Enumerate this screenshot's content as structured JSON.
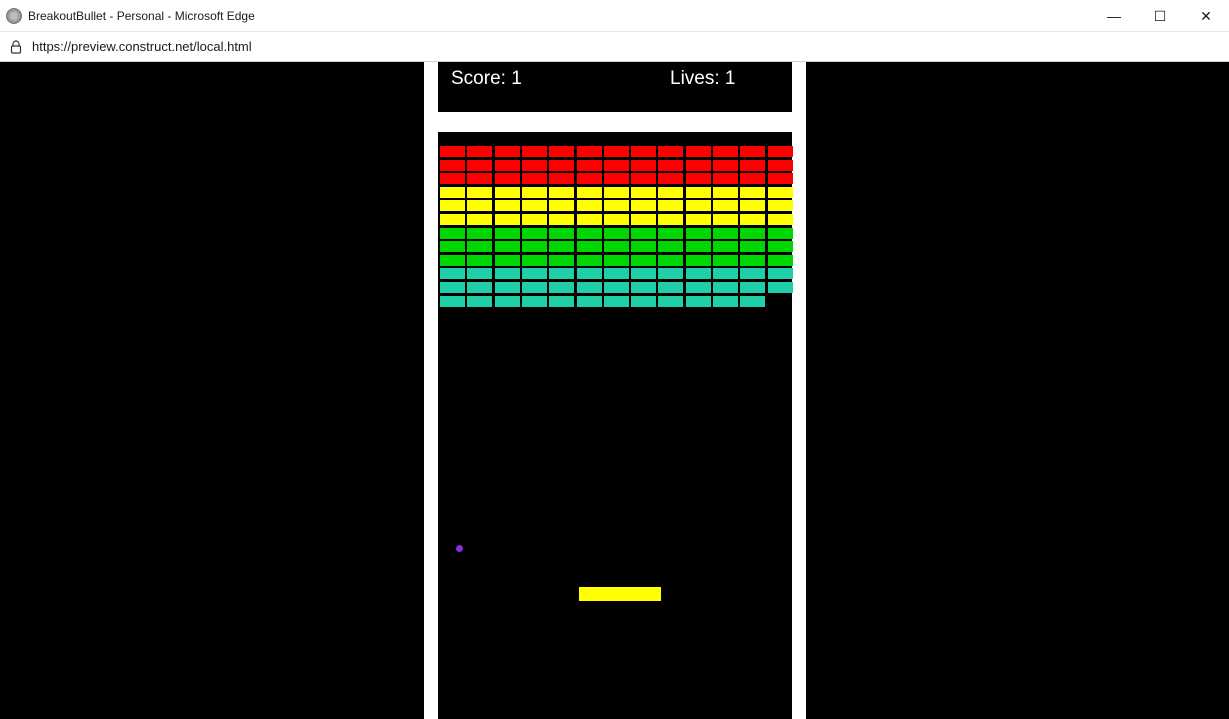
{
  "window": {
    "title": "BreakoutBullet - Personal - Microsoft Edge",
    "minimize_glyph": "—",
    "maximize_glyph": "☐",
    "close_glyph": "✕"
  },
  "address_bar": {
    "url": "https://preview.construct.net/local.html"
  },
  "game": {
    "score_text": "Score: 1",
    "lives_text": "Lives: 1",
    "score": 1,
    "lives": 1,
    "colors": {
      "red": "#ff0000",
      "yellow": "#ffff00",
      "green": "#00d600",
      "teal": "#1fcfa8",
      "ball": "#8a2be2",
      "paddle": "#ffff00",
      "frame": "#ffffff",
      "background": "#000000"
    },
    "brick_rows": [
      {
        "color": "red",
        "count": 13
      },
      {
        "color": "red",
        "count": 13
      },
      {
        "color": "red",
        "count": 13
      },
      {
        "color": "yellow",
        "count": 13
      },
      {
        "color": "yellow",
        "count": 13
      },
      {
        "color": "yellow",
        "count": 13
      },
      {
        "color": "green",
        "count": 13
      },
      {
        "color": "green",
        "count": 13
      },
      {
        "color": "green",
        "count": 13
      },
      {
        "color": "teal",
        "count": 13
      },
      {
        "color": "teal",
        "count": 13
      },
      {
        "color": "teal",
        "count": 12
      }
    ]
  }
}
